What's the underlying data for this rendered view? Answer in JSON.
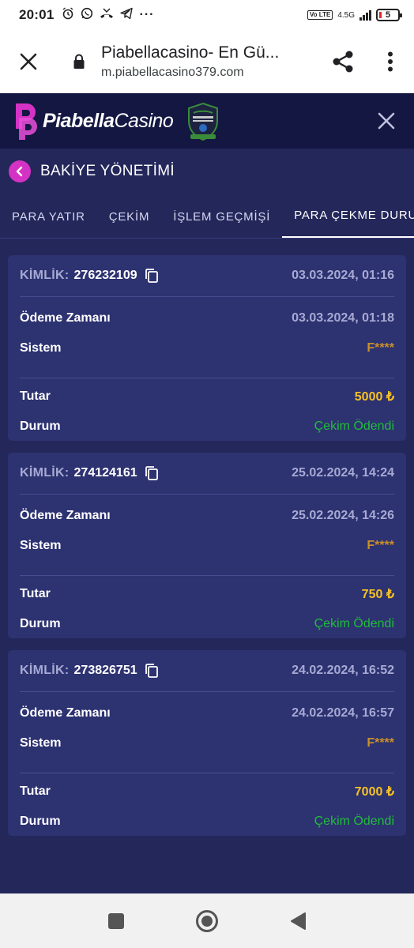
{
  "status_bar": {
    "time": "20:01",
    "network": "4.5G",
    "volte": "Vo LTE",
    "battery": "5"
  },
  "browser": {
    "title": "Piabellacasino- En Gü...",
    "url": "m.piabellacasino379.com"
  },
  "site": {
    "logo_bold": "Piabella",
    "logo_light": "Casino",
    "brand_color": "#d432c4"
  },
  "page": {
    "title": "BAKİYE YÖNETİMİ"
  },
  "tabs": [
    {
      "label": "PARA YATIR",
      "active": false
    },
    {
      "label": "ÇEKİM",
      "active": false
    },
    {
      "label": "İŞLEM GEÇMİŞİ",
      "active": false
    },
    {
      "label": "PARA ÇEKME DURUMU",
      "active": true
    }
  ],
  "labels": {
    "id": "KİMLİK:",
    "payment_time": "Ödeme Zamanı",
    "system": "Sistem",
    "amount": "Tutar",
    "status": "Durum"
  },
  "transactions": [
    {
      "id": "276232109",
      "created": "03.03.2024, 01:16",
      "payment_time": "03.03.2024, 01:18",
      "system": "F****",
      "amount": "5000 ₺",
      "status": "Çekim Ödendi"
    },
    {
      "id": "274124161",
      "created": "25.02.2024, 14:24",
      "payment_time": "25.02.2024, 14:26",
      "system": "F****",
      "amount": "750 ₺",
      "status": "Çekim Ödendi"
    },
    {
      "id": "273826751",
      "created": "24.02.2024, 16:52",
      "payment_time": "24.02.2024, 16:57",
      "system": "F****",
      "amount": "7000 ₺",
      "status": "Çekim Ödendi"
    }
  ],
  "colors": {
    "background": "#23275a",
    "card": "#2d3271",
    "header": "#141741",
    "amount": "#f6c224",
    "status_paid": "#1fbd3a",
    "system": "#c9902a"
  }
}
